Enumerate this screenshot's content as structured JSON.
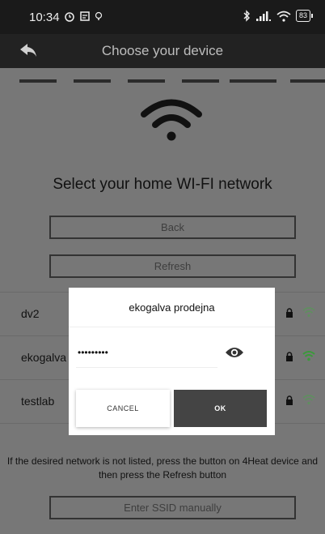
{
  "status_bar": {
    "time": "10:34",
    "battery": "83"
  },
  "app_bar": {
    "title": "Choose your device"
  },
  "main": {
    "headline": "Select your home WI-FI network",
    "back_label": "Back",
    "refresh_label": "Refresh",
    "networks": [
      {
        "ssid": "dv2"
      },
      {
        "ssid": "ekogalva"
      },
      {
        "ssid": "testlab"
      }
    ],
    "hint": "If the desired network is not listed, press the button on 4Heat device and then press the Refresh button",
    "manual_label": "Enter SSID manually"
  },
  "dialog": {
    "title": "ekogalva prodejna",
    "password_value": "•••••••••",
    "cancel_label": "CANCEL",
    "ok_label": "OK"
  },
  "colors": {
    "overlay": "#777777",
    "appbar": "#222222",
    "signal_strong": "#3a9a3a",
    "signal_weak": "#5f8f5f"
  }
}
